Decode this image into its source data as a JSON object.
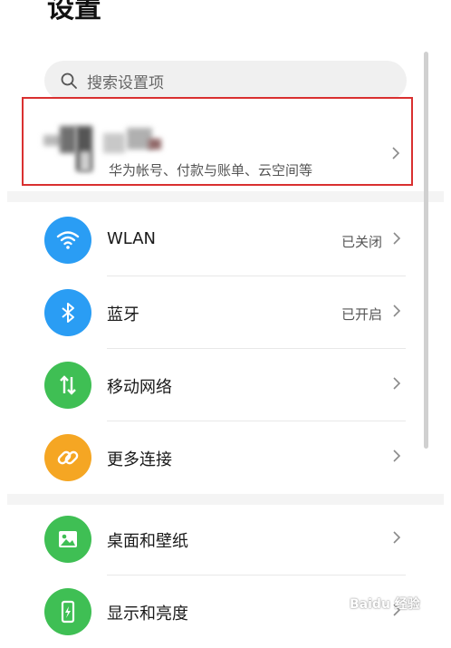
{
  "page_title": "设置",
  "search": {
    "placeholder": "搜索设置项"
  },
  "account": {
    "subtitle": "华为帐号、付款与账单、云空间等"
  },
  "sections": [
    [
      {
        "label": "WLAN",
        "status": "已关闭",
        "icon": "wifi-icon",
        "color": "#2a9df4"
      },
      {
        "label": "蓝牙",
        "status": "已开启",
        "icon": "bluetooth-icon",
        "color": "#2a9df4"
      },
      {
        "label": "移动网络",
        "status": "",
        "icon": "mobile-data-icon",
        "color": "#3fbf54"
      },
      {
        "label": "更多连接",
        "status": "",
        "icon": "link-icon",
        "color": "#f5a623"
      }
    ],
    [
      {
        "label": "桌面和壁纸",
        "status": "",
        "icon": "wallpaper-icon",
        "color": "#3fbf54"
      },
      {
        "label": "显示和亮度",
        "status": "",
        "icon": "display-icon",
        "color": "#3fbf54"
      }
    ]
  ],
  "watermark": "Baidu 经验"
}
